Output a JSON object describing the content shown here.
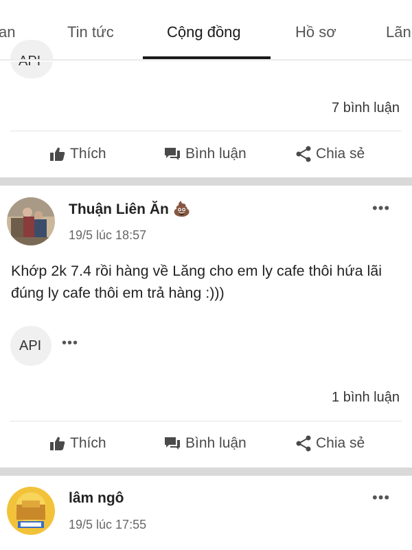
{
  "tabs": [
    {
      "label": "an",
      "active": false
    },
    {
      "label": "Tin tức",
      "active": false
    },
    {
      "label": "Cộng đồng",
      "active": true
    },
    {
      "label": "Hồ sơ",
      "active": false
    },
    {
      "label": "Lãn",
      "active": false
    }
  ],
  "top_post": {
    "api_chip": "API",
    "comment_count": "7 bình luận",
    "actions": {
      "like": "Thích",
      "comment": "Bình luận",
      "share": "Chia sẻ"
    }
  },
  "post": {
    "author": "Thuận Liên Ăn",
    "author_emoji": "💩",
    "timestamp": "19/5 lúc 18:57",
    "more": "•••",
    "text": "Khớp 2k 7.4 rồi hàng về Lăng cho em ly cafe thôi hứa lãi đúng ly cafe thôi em trả hàng :)))",
    "tag_chip": "API",
    "tag_more": "•••",
    "comment_count": "1 bình luận",
    "actions": {
      "like": "Thích",
      "comment": "Bình luận",
      "share": "Chia sẻ"
    }
  },
  "next_post": {
    "author": "lâm ngô",
    "timestamp": "19/5 lúc 17:55",
    "more": "•••"
  },
  "icons": {
    "like": "thumbs-up-icon",
    "comment": "comment-icon",
    "share": "share-icon"
  },
  "colors": {
    "active_tab_underline": "#1a1a1a",
    "separator": "#d9d9d9",
    "chip_background": "#f0f0f0"
  }
}
